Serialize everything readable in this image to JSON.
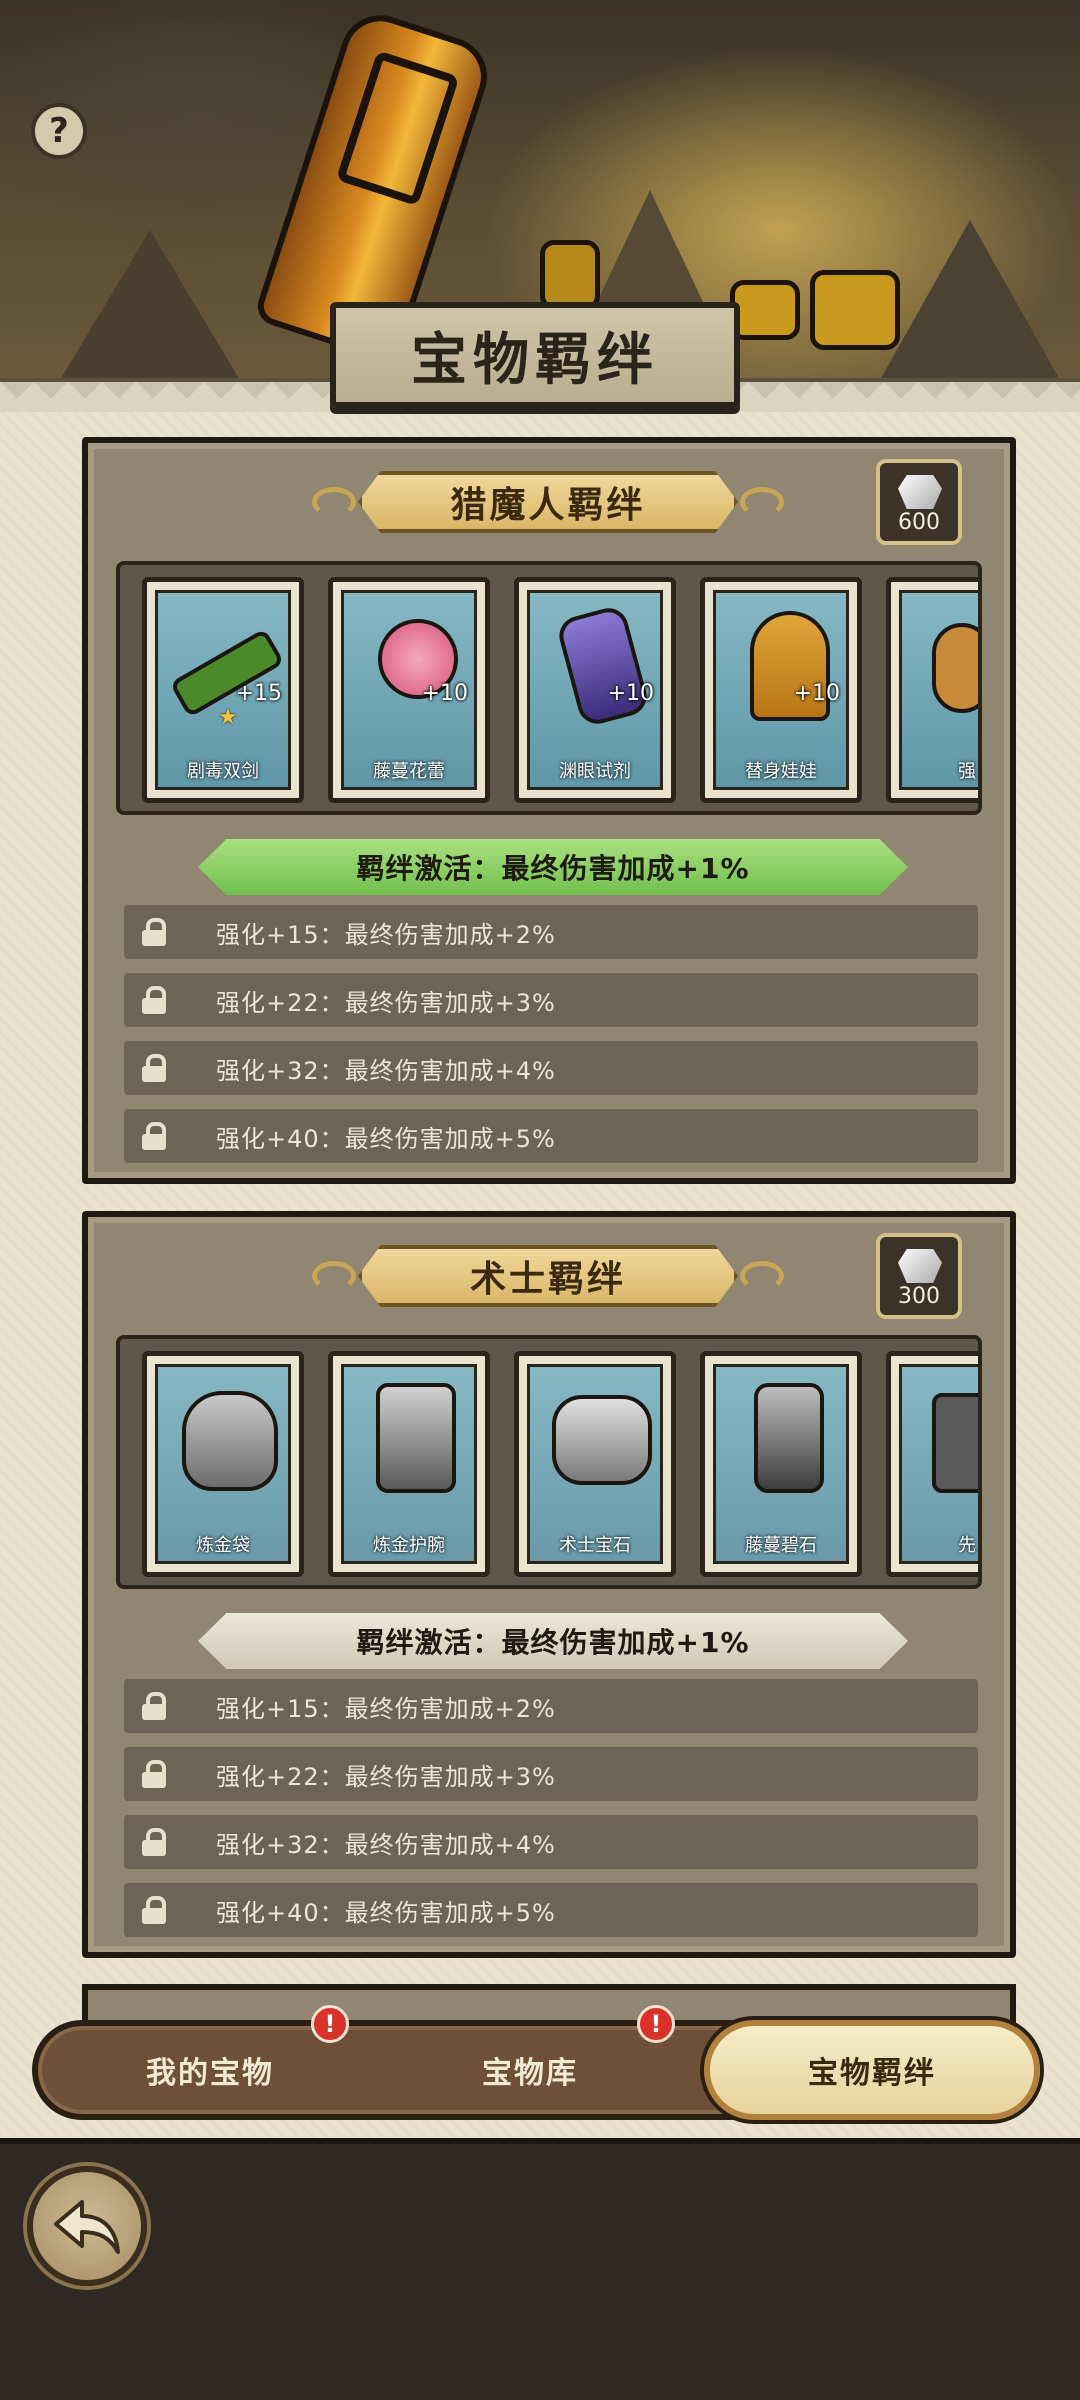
{
  "header": {
    "help_label": "?",
    "title": "宝物羁绊"
  },
  "sections": [
    {
      "title": "猎魔人羁绊",
      "cost": "600",
      "items": [
        {
          "name": "剧毒双剑",
          "level": "+15",
          "star": "★",
          "icon": "poison-blades-icon"
        },
        {
          "name": "藤蔓花蕾",
          "level": "+10",
          "star": "",
          "icon": "vine-bud-icon"
        },
        {
          "name": "渊眼试剂",
          "level": "+10",
          "star": "",
          "icon": "abyss-eye-potion-icon"
        },
        {
          "name": "替身娃娃",
          "level": "+10",
          "star": "",
          "icon": "voodoo-doll-icon"
        },
        {
          "name": "强",
          "level": "",
          "star": "",
          "icon": "partial-item-icon"
        }
      ],
      "activation": {
        "text": "羁绊激活：最终伤害加成+1%",
        "active": true
      },
      "bonuses": [
        "强化+15：最终伤害加成+2%",
        "强化+22：最终伤害加成+3%",
        "强化+32：最终伤害加成+4%",
        "强化+40：最终伤害加成+5%"
      ]
    },
    {
      "title": "术士羁绊",
      "cost": "300",
      "items": [
        {
          "name": "炼金袋",
          "level": "",
          "star": "",
          "icon": "alchemy-bag-icon"
        },
        {
          "name": "炼金护腕",
          "level": "",
          "star": "",
          "icon": "alchemy-bracer-icon"
        },
        {
          "name": "术士宝石",
          "level": "",
          "star": "",
          "icon": "warlock-gem-icon"
        },
        {
          "name": "藤蔓碧石",
          "level": "",
          "star": "",
          "icon": "vine-jade-icon"
        },
        {
          "name": "先",
          "level": "",
          "star": "",
          "icon": "partial-item-icon"
        }
      ],
      "activation": {
        "text": "羁绊激活：最终伤害加成+1%",
        "active": false
      },
      "bonuses": [
        "强化+15：最终伤害加成+2%",
        "强化+22：最终伤害加成+3%",
        "强化+32：最终伤害加成+4%",
        "强化+40：最终伤害加成+5%"
      ]
    }
  ],
  "tabs": [
    {
      "label": "我的宝物",
      "alert": "!",
      "selected": false
    },
    {
      "label": "宝物库",
      "alert": "!",
      "selected": false
    },
    {
      "label": "宝物羁绊",
      "alert": "",
      "selected": true
    }
  ],
  "colors": {
    "active_bar": "#72c04e",
    "alert": "#d9322a",
    "panel": "#908671"
  }
}
